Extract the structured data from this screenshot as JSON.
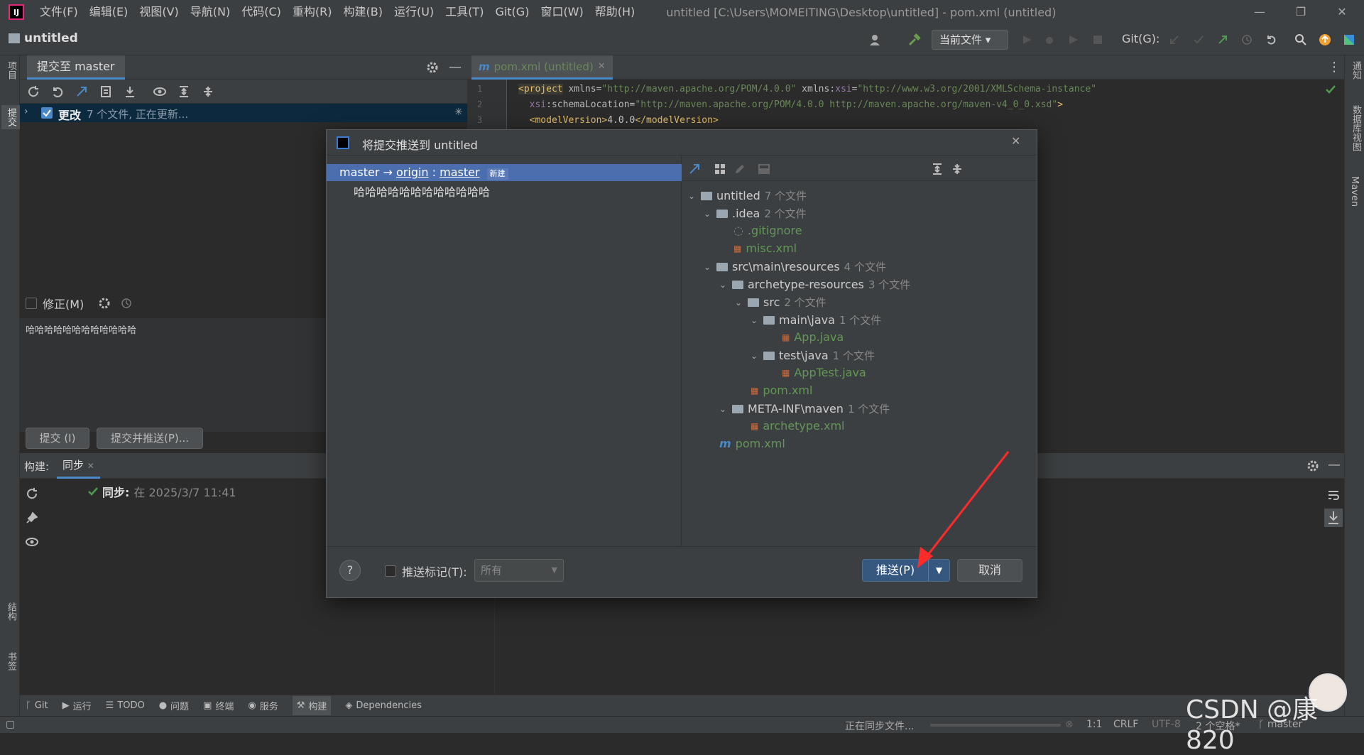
{
  "titlebar": {
    "logo": "IJ",
    "menu": [
      "文件(F)",
      "编辑(E)",
      "视图(V)",
      "导航(N)",
      "代码(C)",
      "重构(R)",
      "构建(B)",
      "运行(U)",
      "工具(T)",
      "Git(G)",
      "窗口(W)",
      "帮助(H)"
    ],
    "window_title": "untitled [C:\\Users\\MOMEITING\\Desktop\\untitled] - pom.xml (untitled)"
  },
  "toolbar": {
    "project_name": "untitled",
    "run_config": "当前文件",
    "git_label": "Git(G):"
  },
  "left_strip": {
    "project": "项目",
    "commit": "提交",
    "structure": "结构",
    "bookmarks": "书签"
  },
  "right_strip": {
    "notifications": "通知",
    "database": "数据库视图",
    "maven": "Maven"
  },
  "commit_panel": {
    "tab_label": "提交至 master",
    "changes_label": "更改",
    "changes_status": "7 个文件, 正在更新...",
    "amend_label": "修正(M)",
    "message": "哈哈哈哈哈哈哈哈哈哈哈哈",
    "commit_button": "提交 (I)",
    "commit_push_button": "提交并推送(P)..."
  },
  "editor": {
    "tab_label": "pom.xml (untitled)",
    "lines": [
      {
        "n": "1",
        "tag_open": "<project",
        "a1": " xmlns=",
        "v1": "\"http://maven.apache.org/POM/4.0.0\"",
        "a2": " xmlns:",
        "ns": "xsi",
        "a3": "=",
        "v2": "\"http://www.w3.org/2001/XMLSchema-instance\""
      },
      {
        "n": "2",
        "pre": "  ",
        "ns": "xsi",
        "a1": ":schemaLocation=",
        "v1": "\"http://maven.apache.org/POM/4.0.0 http://maven.apache.org/maven-v4_0_0.xsd\"",
        "tag_close": ">"
      },
      {
        "n": "3",
        "pre": "  ",
        "tag_open": "<modelVersion>",
        "text": "4.0.0",
        "tag_close": "</modelVersion>"
      }
    ]
  },
  "build_panel": {
    "label": "构建:",
    "tab": "同步",
    "sync_label": "同步:",
    "sync_time": "在 2025/3/7 11:41"
  },
  "tool_tabs": [
    "Git",
    "运行",
    "TODO",
    "问题",
    "终端",
    "服务",
    "构建",
    "Dependencies"
  ],
  "status_bar": {
    "task": "正在同步文件...",
    "position": "1:1",
    "line_sep": "CRLF",
    "encoding": "UTF-8",
    "indent": "2 个空格*",
    "branch": "master"
  },
  "dialog": {
    "title": "将提交推送到 untitled",
    "branch_local": "master",
    "arrow": " → ",
    "remote": "origin",
    "sep": " : ",
    "branch_remote": "master",
    "new_badge": "新建",
    "commit_message": "哈哈哈哈哈哈哈哈哈哈哈哈",
    "tree": [
      {
        "name": "untitled",
        "count": "7 个文件",
        "type": "dir"
      },
      {
        "name": ".idea",
        "count": "2 个文件",
        "type": "dir"
      },
      {
        "name": ".gitignore",
        "type": "file"
      },
      {
        "name": "misc.xml",
        "type": "file"
      },
      {
        "name": "src\\main\\resources",
        "count": "4 个文件",
        "type": "dir"
      },
      {
        "name": "archetype-resources",
        "count": "3 个文件",
        "type": "dir"
      },
      {
        "name": "src",
        "count": "2 个文件",
        "type": "dir"
      },
      {
        "name": "main\\java",
        "count": "1 个文件",
        "type": "dir"
      },
      {
        "name": "App.java",
        "type": "file"
      },
      {
        "name": "test\\java",
        "count": "1 个文件",
        "type": "dir"
      },
      {
        "name": "AppTest.java",
        "type": "file"
      },
      {
        "name": "pom.xml",
        "type": "file"
      },
      {
        "name": "META-INF\\maven",
        "count": "1 个文件",
        "type": "dir"
      },
      {
        "name": "archetype.xml",
        "type": "file"
      },
      {
        "name": "pom.xml",
        "type": "file"
      }
    ],
    "help": "?",
    "push_tags_label": "推送标记(T):",
    "push_tags_value": "所有",
    "push_button": "推送(P)",
    "cancel_button": "取消"
  },
  "watermark": "CSDN @康820",
  "colors": {
    "accent": "#4a88c7",
    "selection": "#4b6eaf",
    "primary_button": "#365880",
    "file_added": "#629755",
    "annotation_arrow": "#ff2a2a"
  }
}
